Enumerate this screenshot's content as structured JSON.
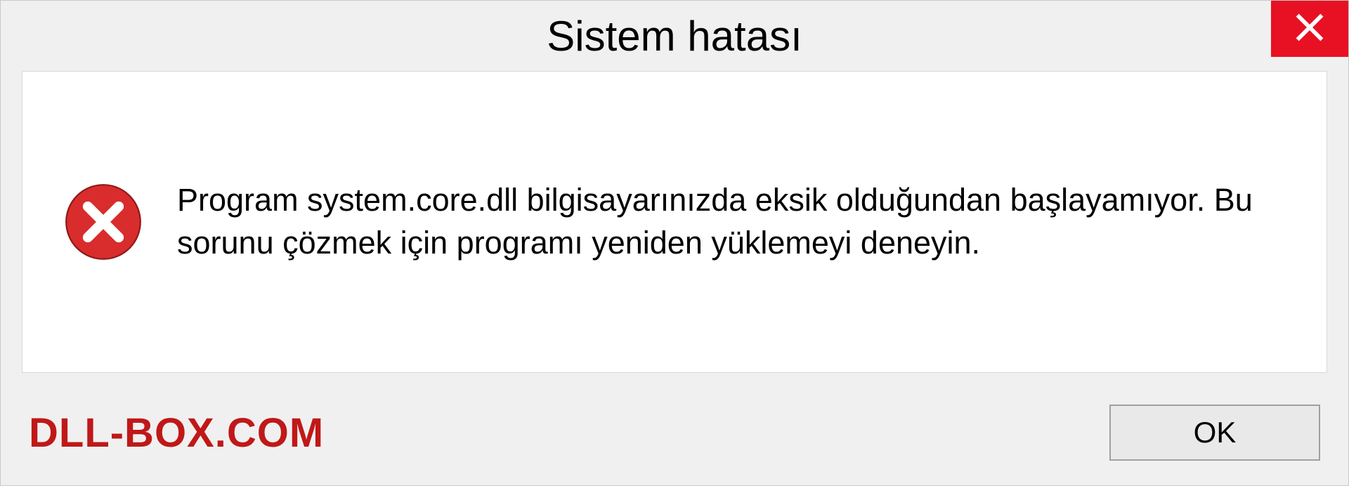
{
  "titlebar": {
    "title": "Sistem hatası"
  },
  "message": {
    "text": "Program system.core.dll bilgisayarınızda eksik olduğundan başlayamıyor. Bu sorunu çözmek için programı yeniden yüklemeyi deneyin."
  },
  "footer": {
    "brand": "DLL-BOX.COM",
    "ok_label": "OK"
  },
  "colors": {
    "close_bg": "#e81123",
    "brand_color": "#c01818"
  }
}
